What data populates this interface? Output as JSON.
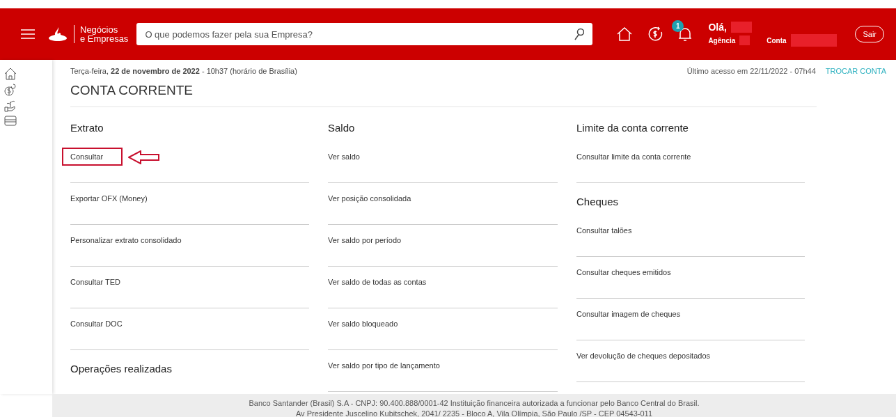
{
  "header": {
    "brand_line_1": "Negócios",
    "brand_line_2": "e Empresas",
    "search": {
      "placeholder": "O que podemos fazer pela sua Empresa?"
    },
    "notification_count": "1",
    "greeting": "Olá,",
    "agency_label": "Agência",
    "account_label": "Conta",
    "logout": "Sair"
  },
  "info": {
    "date": "Terça-feira, **22 de novembro de 2022** - 10h37 (horário de Brasília)",
    "last_access": "Último acesso em  22/11/2022 - 07h44",
    "switch_account": "TROCAR CONTA"
  },
  "title": "CONTA CORRENTE",
  "columns": [
    {
      "sections": [
        {
          "heading": "Extrato",
          "items": [
            {
              "label": "Consultar",
              "highlighted": true
            },
            {
              "label": "Exportar OFX (Money)",
              "highlighted": false
            },
            {
              "label": "Personalizar extrato consolidado",
              "highlighted": false
            },
            {
              "label": "Consultar TED",
              "highlighted": false
            },
            {
              "label": "Consultar DOC",
              "highlighted": false
            }
          ]
        },
        {
          "heading": "Operações realizadas"
        }
      ]
    },
    {
      "sections": [
        {
          "heading": "Saldo",
          "items": [
            {
              "label": "Ver saldo",
              "highlighted": false
            },
            {
              "label": "Ver posição consolidada",
              "highlighted": false
            },
            {
              "label": "Ver saldo por período",
              "highlighted": false
            },
            {
              "label": "Ver saldo de todas as contas",
              "highlighted": false
            },
            {
              "label": "Ver saldo bloqueado",
              "highlighted": false
            },
            {
              "label": "Ver saldo por tipo de lançamento",
              "highlighted": false
            }
          ]
        }
      ]
    },
    {
      "sections": [
        {
          "heading": "Limite da conta corrente",
          "items": [
            {
              "label": "Consultar limite da conta corrente",
              "highlighted": false
            }
          ]
        },
        {
          "heading": "Cheques",
          "items": [
            {
              "label": "Consultar talões",
              "highlighted": false
            },
            {
              "label": "Consultar cheques emitidos",
              "highlighted": false
            },
            {
              "label": "Consultar imagem de cheques",
              "highlighted": false
            },
            {
              "label": "Ver devolução de cheques depositados",
              "highlighted": false
            }
          ]
        }
      ]
    }
  ],
  "footer": [
    "Banco Santander (Brasil) S.A - CNPJ: 90.400.888/0001-42 Instituição financeira autorizada a funcionar pelo Banco Central do Brasil.",
    "Av Presidente Juscelino Kubitschek, 2041/ 2235 - Bloco A, Vila Olímpia, São Paulo /SP - CEP 04543-011"
  ]
}
